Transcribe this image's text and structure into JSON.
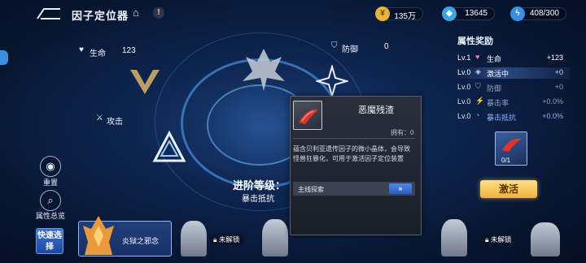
{
  "header": {
    "title": "因子定位器",
    "resources": [
      {
        "icon": "gold-coin-icon",
        "value": "135万"
      },
      {
        "icon": "diamond-icon",
        "value": "13645"
      },
      {
        "icon": "energy-icon",
        "value": "408/300"
      }
    ]
  },
  "stats": {
    "hp_label": "生命",
    "hp_value": "123",
    "def_label": "防御",
    "def_value": "0",
    "atk_label": "攻击"
  },
  "left_buttons": {
    "reset_label": "重置",
    "overview_label": "属性总览",
    "quick_select_label": "快速选择"
  },
  "center": {
    "advance_label": "进阶等级：",
    "advance_sub": "暴击抵抗"
  },
  "rewards": {
    "title": "属性奖励",
    "rows": [
      {
        "lv": "Lv.1",
        "name": "生命",
        "amount": "+123"
      },
      {
        "lv": "Lv.0",
        "name": "激活中",
        "amount": "+0"
      },
      {
        "lv": "Lv.0",
        "name": "防御",
        "amount": "+0"
      },
      {
        "lv": "Lv.0",
        "name": "暴击率",
        "amount": "+0.0%"
      },
      {
        "lv": "Lv.0",
        "name": "暴击抵抗",
        "amount": "+0.0%"
      }
    ],
    "item_count": "0/1",
    "activate_label": "激活"
  },
  "popup": {
    "title": "恶魔残渣",
    "owned": "拥有：0",
    "description": "蕴含贝利亚遗传因子的微小晶体，会导致怪兽狂暴化，可用于激活因子定位装置",
    "source_label": "主线探索",
    "go_label": "»"
  },
  "bottom": {
    "selected_name": "炎狱之邪念",
    "locked_label": "未解锁",
    "locked_label_2": "未解锁"
  },
  "colors": {
    "accent_gold": "#f0b23a",
    "accent_blue": "#2a5fc4"
  }
}
